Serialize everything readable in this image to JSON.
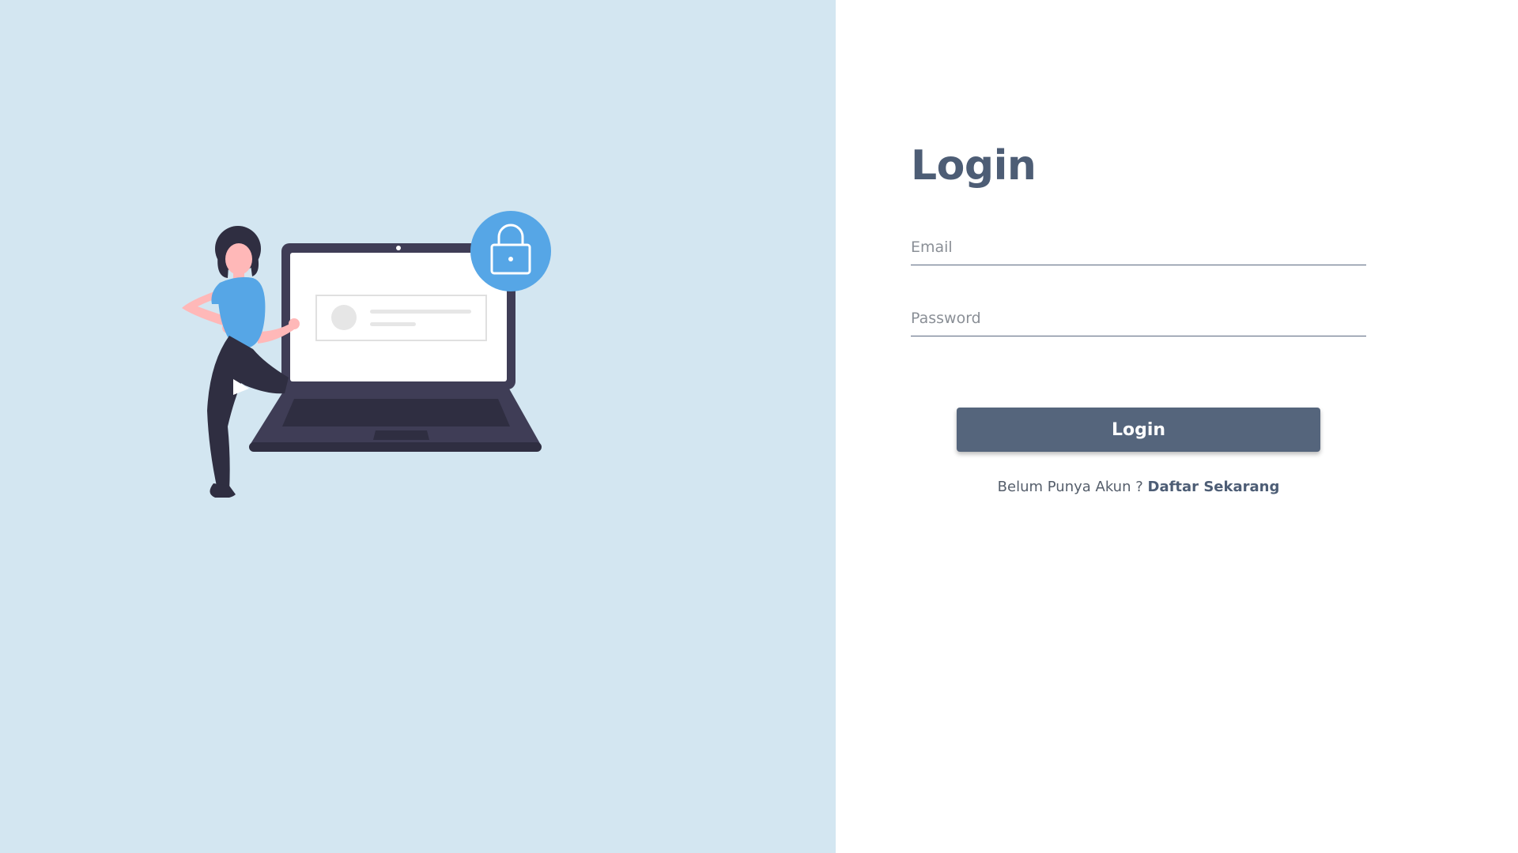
{
  "login_form": {
    "title": "Login",
    "email_placeholder": "Email",
    "email_value": "",
    "password_placeholder": "Password",
    "password_value": "",
    "submit_label": "Login",
    "register_prompt": "Belum Punya Akun ?",
    "register_link": "Daftar Sekarang"
  },
  "illustration": {
    "icon": "woman-with-laptop-lock-illustration"
  },
  "colors": {
    "left_background": "#d3e6f1",
    "accent_blue": "#56a6e6",
    "button": "#55657c",
    "title": "#4d5d75",
    "laptop_dark": "#3f3d56"
  }
}
